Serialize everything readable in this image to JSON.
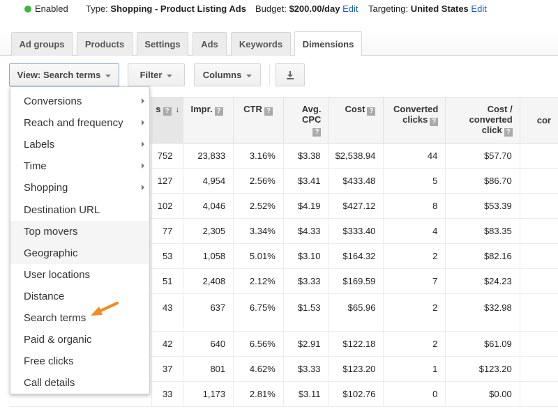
{
  "status": {
    "state": "Enabled",
    "type_label": "Type:",
    "type_value": "Shopping - Product Listing Ads",
    "budget_label": "Budget:",
    "budget_value": "$200.00/day",
    "budget_edit": "Edit",
    "targeting_label": "Targeting:",
    "targeting_value": "United States",
    "targeting_edit": "Edit",
    "status_color": "#3cb83c"
  },
  "tabs": [
    {
      "label": "Ad groups",
      "active": false
    },
    {
      "label": "Products",
      "active": false
    },
    {
      "label": "Settings",
      "active": false
    },
    {
      "label": "Ads",
      "active": false
    },
    {
      "label": "Keywords",
      "active": false
    },
    {
      "label": "Dimensions",
      "active": true
    }
  ],
  "toolbar": {
    "view_label": "View: Search terms",
    "filter_label": "Filter",
    "columns_label": "Columns",
    "download_icon": "download-icon"
  },
  "menu": {
    "items": [
      {
        "label": "Conversions",
        "submenu": true
      },
      {
        "label": "Reach and frequency",
        "submenu": true
      },
      {
        "label": "Labels",
        "submenu": true
      },
      {
        "label": "Time",
        "submenu": true
      },
      {
        "label": "Shopping",
        "submenu": true
      },
      {
        "label": "Destination URL",
        "submenu": false
      },
      {
        "label": "Top movers",
        "submenu": false
      },
      {
        "label": "Geographic",
        "submenu": false
      },
      {
        "label": "User locations",
        "submenu": false
      },
      {
        "label": "Distance",
        "submenu": false
      },
      {
        "label": "Search terms",
        "submenu": false
      },
      {
        "label": "Paid & organic",
        "submenu": false
      },
      {
        "label": "Free clicks",
        "submenu": false
      },
      {
        "label": "Call details",
        "submenu": false
      }
    ],
    "annotation_color": "#f28c1e"
  },
  "table": {
    "headers": {
      "clicks": "s",
      "impr": "Impr.",
      "ctr": "CTR",
      "avg_cpc_1": "Avg.",
      "avg_cpc_2": "CPC",
      "cost": "Cost",
      "conv_1": "Converted",
      "conv_2": "clicks",
      "cpc_1": "Cost /",
      "cpc_2": "converted",
      "cpc_3": "click",
      "last": "cor"
    },
    "rows": [
      {
        "clicks": "752",
        "impr": "23,833",
        "ctr": "3.16%",
        "avg_cpc": "$3.38",
        "cost": "$2,538.94",
        "conv": "44",
        "cost_conv": "$57.70"
      },
      {
        "clicks": "127",
        "impr": "4,954",
        "ctr": "2.56%",
        "avg_cpc": "$3.41",
        "cost": "$433.48",
        "conv": "5",
        "cost_conv": "$86.70"
      },
      {
        "clicks": "102",
        "impr": "4,046",
        "ctr": "2.52%",
        "avg_cpc": "$4.19",
        "cost": "$427.12",
        "conv": "8",
        "cost_conv": "$53.39"
      },
      {
        "clicks": "77",
        "impr": "2,305",
        "ctr": "3.34%",
        "avg_cpc": "$4.33",
        "cost": "$333.40",
        "conv": "4",
        "cost_conv": "$83.35"
      },
      {
        "clicks": "53",
        "impr": "1,058",
        "ctr": "5.01%",
        "avg_cpc": "$3.10",
        "cost": "$164.32",
        "conv": "2",
        "cost_conv": "$82.16"
      },
      {
        "clicks": "51",
        "impr": "2,408",
        "ctr": "2.12%",
        "avg_cpc": "$3.33",
        "cost": "$169.59",
        "conv": "7",
        "cost_conv": "$24.23"
      },
      {
        "clicks": "43",
        "impr": "637",
        "ctr": "6.75%",
        "avg_cpc": "$1.53",
        "cost": "$65.96",
        "conv": "2",
        "cost_conv": "$32.98"
      },
      {
        "clicks": "42",
        "impr": "640",
        "ctr": "6.56%",
        "avg_cpc": "$2.91",
        "cost": "$122.18",
        "conv": "2",
        "cost_conv": "$61.09"
      },
      {
        "clicks": "37",
        "impr": "801",
        "ctr": "4.62%",
        "avg_cpc": "$3.33",
        "cost": "$123.20",
        "conv": "1",
        "cost_conv": "$123.20"
      },
      {
        "clicks": "33",
        "impr": "1,173",
        "ctr": "2.81%",
        "avg_cpc": "$3.11",
        "cost": "$102.76",
        "conv": "0",
        "cost_conv": "$0.00"
      }
    ]
  }
}
